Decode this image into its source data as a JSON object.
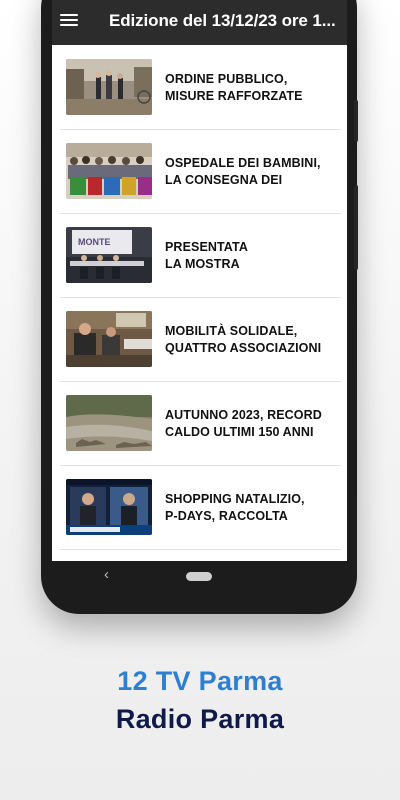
{
  "app_bar": {
    "menu_icon": "hamburger-menu-icon",
    "title": "Edizione del 13/12/23 ore 1..."
  },
  "news_items": [
    {
      "title": "ORDINE PUBBLICO,\nMISURE RAFFORZATE"
    },
    {
      "title": "OSPEDALE DEI BAMBINI,\nLA CONSEGNA DEI"
    },
    {
      "title": "PRESENTATA\nLA MOSTRA"
    },
    {
      "title": "MOBILITÀ SOLIDALE,\nQUATTRO ASSOCIAZIONI"
    },
    {
      "title": "AUTUNNO 2023, RECORD\nCALDO ULTIMI 150 ANNI"
    },
    {
      "title": "SHOPPING NATALIZIO,\nP-DAYS, RACCOLTA"
    }
  ],
  "thumb3_text": "MONTE",
  "nav_bar": {
    "back_icon": "‹",
    "home_icon": "home-pill-icon"
  },
  "branding": {
    "line1": "12 TV Parma",
    "line2": "Radio Parma",
    "line1_color": "#2f7fd1",
    "line2_color": "#0f1a4a"
  }
}
